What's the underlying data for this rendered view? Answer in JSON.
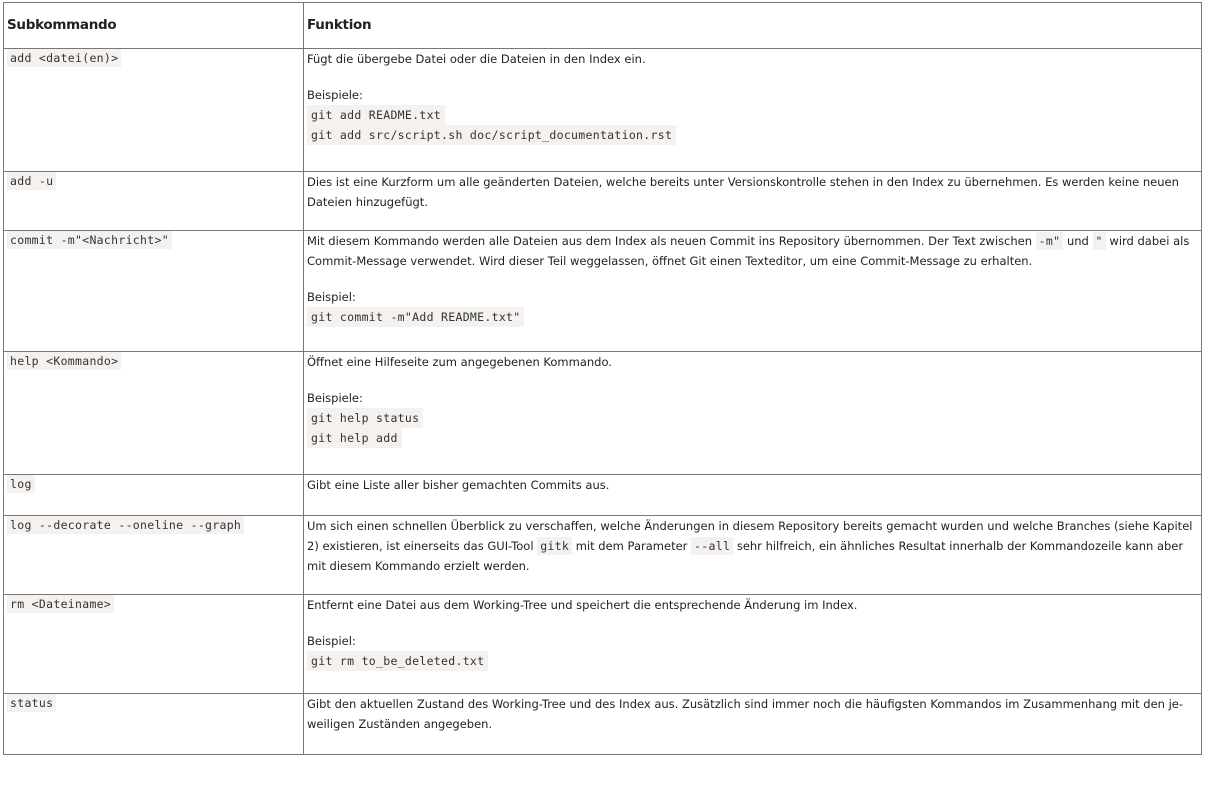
{
  "header": {
    "col1": "Subkommando",
    "col2": "Funktion"
  },
  "rows": [
    {
      "cmd": "add <datei(en)>",
      "desc": "Fügt die übergebe Datei oder die Dateien in den Index ein.",
      "example_label": "Beispiele:",
      "examples": [
        "git add README.txt",
        "git add src/script.sh doc/script_documentation.rst"
      ]
    },
    {
      "cmd": "add -u",
      "desc": "Dies ist eine Kurzform um alle geänderten Dateien, welche bereits unter Versionskontrolle stehen in den Index zu übernehmen. Es werden keine neuen Dateien hinzugefügt."
    },
    {
      "cmd": "commit -m\"<Nachricht>\"",
      "desc_a": "Mit diesem Kommando werden alle Dateien aus dem Index als neuen Commit ins Repository übernommen. Der Text zwischen",
      "code_a": "-m\"",
      "desc_b": "und",
      "code_b": "\"",
      "desc_c": "wird dabei als Commit-Message verwendet. Wird dieser Teil weggelassen, öffnet Git einen Texteditor, um eine Commit-Message zu erhalten.",
      "example_label": "Beispiel:",
      "examples": [
        "git commit -m\"Add README.txt\""
      ]
    },
    {
      "cmd": "help <Kommando>",
      "desc": "Öffnet eine Hilfeseite zum angegebenen Kommando.",
      "example_label": "Beispiele:",
      "examples": [
        "git help status",
        "git help add"
      ]
    },
    {
      "cmd": "log",
      "desc": "Gibt eine Liste aller bisher gemachten Commits aus."
    },
    {
      "cmd": "log --decorate --oneline --graph",
      "desc_a": "Um sich einen schnellen Überblick zu verschaffen, welche Änderungen in diesem Repository bereits gemacht wurden und welche Branches (siehe Kapitel 2) existieren, ist einerseits das GUI-Tool",
      "code_a": "gitk",
      "desc_b": "mit dem Parameter",
      "code_b": "--all",
      "desc_c": "sehr hilfreich, ein ähnliches Resultat innerhalb der Kommandozeile kann aber mit diesem Kommando erzielt werden."
    },
    {
      "cmd": "rm <Dateiname>",
      "desc": "Entfernt eine Datei aus dem Working-Tree und speichert die entsprechende Änderung im Index.",
      "example_label": "Beispiel:",
      "examples": [
        "git rm to_be_deleted.txt"
      ]
    },
    {
      "cmd": "status",
      "desc": "Gibt den aktuellen Zustand des Working-Tree und des Index aus. Zusätzlich sind immer noch die häufigsten Kommandos im Zusammenhang mit den je-weiligen Zuständen angegeben."
    }
  ]
}
